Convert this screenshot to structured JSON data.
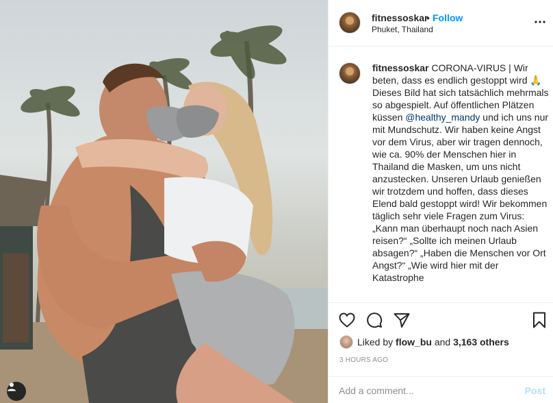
{
  "photo": {
    "description_icon": "user-tag-icon"
  },
  "header": {
    "username": "fitnessoskar",
    "dot": "•",
    "follow_label": "Follow",
    "location": "Phuket, Thailand",
    "more_icon": "more-options-icon"
  },
  "caption": {
    "username": "fitnessoskar",
    "text_part1": "CORONA-VIRUS | Wir beten, dass es endlich gestoppt wird 🙏 Dieses Bild hat sich tatsächlich mehrmals so abgespielt. Auf öffentlichen Plätzen küssen ",
    "mention": "@healthy_mandy",
    "text_part2": " und ich uns nur mit Mundschutz. Wir haben keine Angst vor dem Virus, aber wir tragen dennoch, wie ca. 90% der Menschen hier in Thailand die Masken, um uns nicht anzustecken. Unseren Urlaub genießen wir trotzdem und hoffen, dass dieses Elend bald gestoppt wird! Wir bekommen täglich sehr viele Fragen zum Virus: „Kann man überhaupt noch nach Asien reisen?“ „Sollte ich meinen Urlaub absagen?“ „Haben die Menschen vor Ort Angst?“ „Wie wird hier mit der Katastrophe"
  },
  "actions": {
    "like_icon": "heart-icon",
    "comment_icon": "comment-icon",
    "share_icon": "share-icon",
    "save_icon": "bookmark-icon"
  },
  "likes": {
    "prefix": "Liked by",
    "user": "flow_bu",
    "middle": "and",
    "others": "3,163 others"
  },
  "timestamp": "3 HOURS AGO",
  "comment": {
    "placeholder": "Add a comment...",
    "post_label": "Post"
  },
  "colors": {
    "accent": "#0095f6",
    "mention": "#00376b",
    "muted": "#8e8e8e",
    "post_disabled": "#b2dffc",
    "border": "#efefef"
  }
}
